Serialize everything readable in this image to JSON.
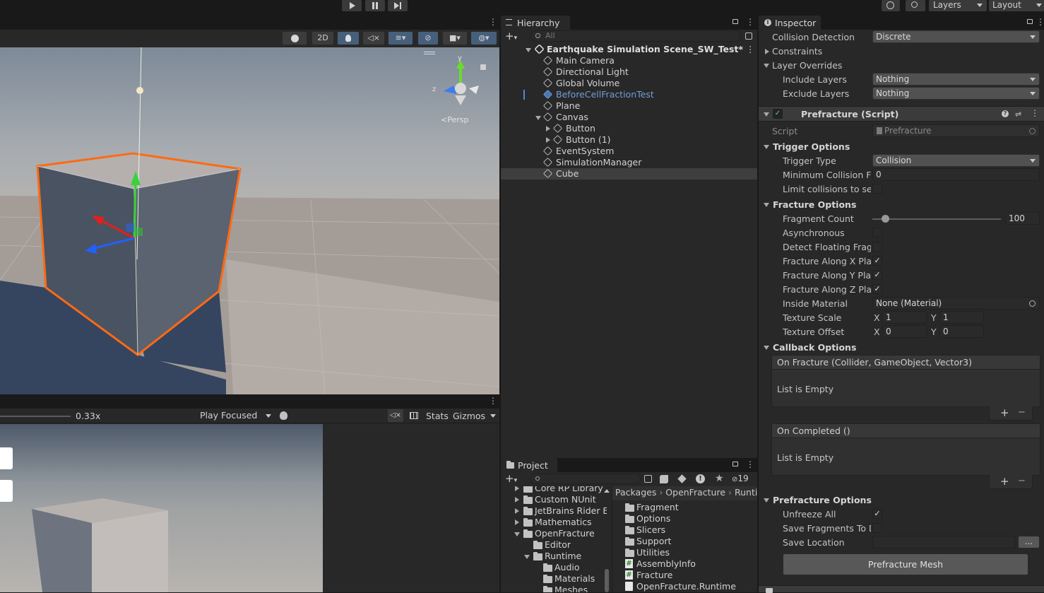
{
  "toolbar": {
    "layers_label": "Layers",
    "layout_label": "Layout"
  },
  "scene": {
    "two_d_label": "2D",
    "persp_label": "Persp",
    "axis_x": "z",
    "axis_y": "y"
  },
  "game": {
    "scale_value": "0.33x",
    "play_mode_label": "Play Focused",
    "stats_label": "Stats",
    "gizmos_label": "Gizmos"
  },
  "hierarchy": {
    "tab_label": "Hierarchy",
    "search_placeholder": "All",
    "scene_name": "Earthquake Simulation Scene_SW_Test*",
    "items": [
      {
        "label": "Main Camera"
      },
      {
        "label": "Directional Light"
      },
      {
        "label": "Global Volume"
      },
      {
        "label": "BeforeCellFractionTest"
      },
      {
        "label": "Plane"
      },
      {
        "label": "Canvas"
      },
      {
        "label": "Button"
      },
      {
        "label": "Button (1)"
      },
      {
        "label": "EventSystem"
      },
      {
        "label": "SimulationManager"
      },
      {
        "label": "Cube"
      }
    ]
  },
  "project": {
    "tab_label": "Project",
    "hidden_count": "19",
    "breadcrumb": [
      "Packages",
      "OpenFracture",
      "Runtime"
    ],
    "tree": [
      {
        "label": "Core RP Library"
      },
      {
        "label": "Custom NUnit"
      },
      {
        "label": "JetBrains Rider E"
      },
      {
        "label": "Mathematics"
      },
      {
        "label": "OpenFracture"
      },
      {
        "label": "Editor"
      },
      {
        "label": "Runtime"
      },
      {
        "label": "Audio"
      },
      {
        "label": "Materials"
      },
      {
        "label": "Meshes"
      }
    ],
    "files": [
      {
        "label": "Fragment"
      },
      {
        "label": "Options"
      },
      {
        "label": "Slicers"
      },
      {
        "label": "Support"
      },
      {
        "label": "Utilities"
      },
      {
        "label": "AssemblyInfo"
      },
      {
        "label": "Fracture"
      },
      {
        "label": "OpenFracture.Runtime"
      }
    ]
  },
  "inspector": {
    "tab_label": "Inspector",
    "collision_detection": {
      "label": "Collision Detection",
      "value": "Discrete"
    },
    "constraints_label": "Constraints",
    "layer_overrides_label": "Layer Overrides",
    "include_layers": {
      "label": "Include Layers",
      "value": "Nothing"
    },
    "exclude_layers": {
      "label": "Exclude Layers",
      "value": "Nothing"
    },
    "component_title": "Prefracture (Script)",
    "script": {
      "label": "Script",
      "value": "Prefracture"
    },
    "trigger_options_label": "Trigger Options",
    "trigger_type": {
      "label": "Trigger Type",
      "value": "Collision"
    },
    "min_collision_force": {
      "label": "Minimum Collision Force",
      "value": "0"
    },
    "limit_collisions": {
      "label": "Limit collisions to selected"
    },
    "fracture_options_label": "Fracture Options",
    "fragment_count": {
      "label": "Fragment Count",
      "value": "100",
      "slider_fraction": 0.04
    },
    "asynchronous": {
      "label": "Asynchronous"
    },
    "detect_floating": {
      "label": "Detect Floating Fragments"
    },
    "along_x": {
      "label": "Fracture Along X Plane"
    },
    "along_y": {
      "label": "Fracture Along Y Plane"
    },
    "along_z": {
      "label": "Fracture Along Z Plane"
    },
    "inside_material": {
      "label": "Inside Material",
      "value": "None (Material)"
    },
    "texture_scale": {
      "label": "Texture Scale",
      "x": "1",
      "y": "1"
    },
    "texture_offset": {
      "label": "Texture Offset",
      "x": "0",
      "y": "0"
    },
    "x_label": "X",
    "y_label": "Y",
    "callback_options_label": "Callback Options",
    "on_fracture": {
      "title": "On Fracture (Collider, GameObject, Vector3)",
      "empty": "List is Empty"
    },
    "on_completed": {
      "title": "On Completed ()",
      "empty": "List is Empty"
    },
    "prefracture_options_label": "Prefracture Options",
    "unfreeze_all": {
      "label": "Unfreeze All"
    },
    "save_fragments": {
      "label": "Save Fragments To Disk"
    },
    "save_location": {
      "label": "Save Location",
      "value": "",
      "browse": "..."
    },
    "prefracture_button": "Prefracture Mesh",
    "plus": "+",
    "minus": "−",
    "check": "✓"
  }
}
